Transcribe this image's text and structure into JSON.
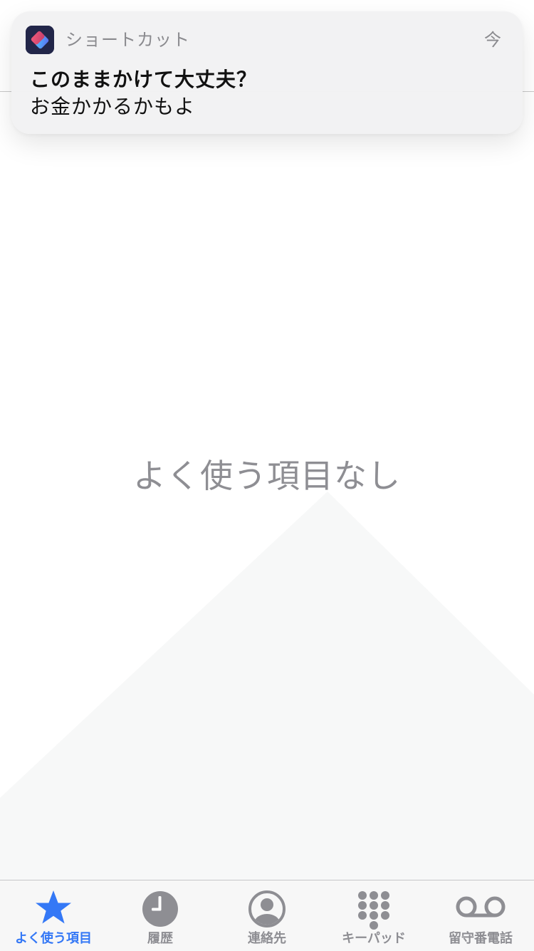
{
  "notification": {
    "app_name": "ショートカット",
    "timestamp": "今",
    "title": "このままかけて大丈夫？",
    "body": "お金かかるかもよ",
    "app_icon": "shortcuts-icon"
  },
  "main": {
    "empty_message": "よく使う項目なし"
  },
  "tab_bar": {
    "tabs": [
      {
        "label": "よく使う項目",
        "icon": "star-icon",
        "active": true
      },
      {
        "label": "履歴",
        "icon": "clock-icon",
        "active": false
      },
      {
        "label": "連絡先",
        "icon": "person-circle-icon",
        "active": false
      },
      {
        "label": "キーパッド",
        "icon": "keypad-icon",
        "active": false
      },
      {
        "label": "留守番電話",
        "icon": "voicemail-icon",
        "active": false
      }
    ]
  },
  "colors": {
    "accent": "#3478f6",
    "inactive": "#8e8e93"
  }
}
